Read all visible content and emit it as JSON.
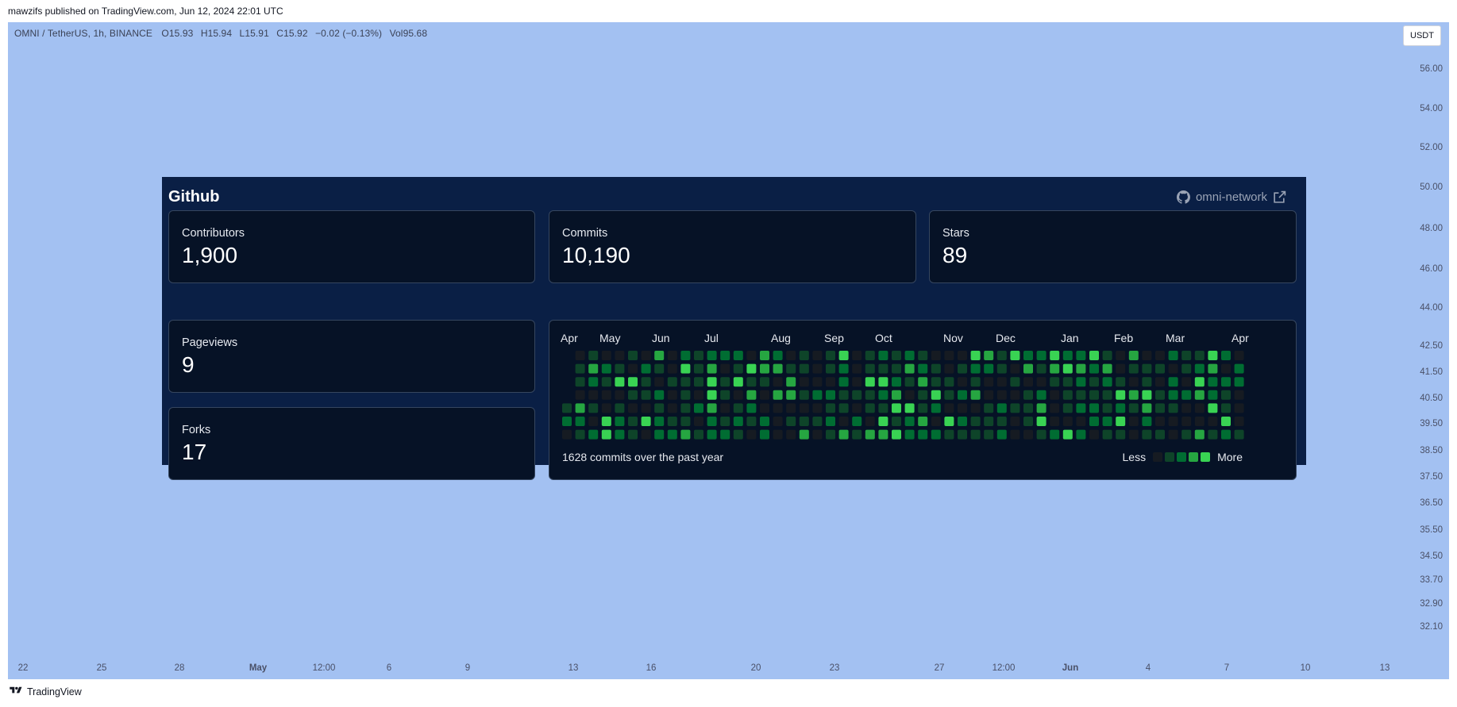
{
  "header": {
    "published_text": "mawzifs published on TradingView.com, Jun 12, 2024 22:01 UTC"
  },
  "ohlc": {
    "symbol": "OMNI / TetherUS, 1h, BINANCE",
    "open": "O15.93",
    "high": "H15.94",
    "low": "L15.91",
    "close": "C15.92",
    "change": "−0.02 (−0.13%)",
    "volume": "Vol95.68"
  },
  "currency_button": "USDT",
  "y_axis_ticks": [
    "56.00",
    "54.00",
    "52.00",
    "50.00",
    "48.00",
    "46.00",
    "44.00",
    "42.50",
    "41.50",
    "40.50",
    "39.50",
    "38.50",
    "37.50",
    "36.50",
    "35.50",
    "34.50",
    "33.70",
    "32.90",
    "32.10"
  ],
  "x_axis_ticks": [
    "22",
    "25",
    "28",
    "May",
    "12:00",
    "6",
    "9",
    "13",
    "16",
    "20",
    "23",
    "27",
    "12:00",
    "Jun",
    "4",
    "7",
    "10",
    "13"
  ],
  "x_axis_bold": [
    "May",
    "Jun"
  ],
  "brand": "TradingView",
  "github": {
    "title": "Github",
    "org_link": "omni-network",
    "stats": [
      {
        "label": "Contributors",
        "value": "1,900"
      },
      {
        "label": "Commits",
        "value": "10,190"
      },
      {
        "label": "Stars",
        "value": "89"
      },
      {
        "label": "Pageviews",
        "value": "9"
      },
      {
        "label": "Forks",
        "value": "17"
      }
    ],
    "contributions": {
      "months": [
        "Apr",
        "May",
        "Jun",
        "Jul",
        "Aug",
        "Sep",
        "Oct",
        "Nov",
        "Dec",
        "Jan",
        "Feb",
        "Mar",
        "Apr"
      ],
      "footer_text": "1628 commits over the past year",
      "legend_less": "Less",
      "legend_more": "More",
      "level_colors": [
        "#161b22",
        "#0e4429",
        "#006d32",
        "#26a641",
        "#39d353"
      ]
    }
  }
}
